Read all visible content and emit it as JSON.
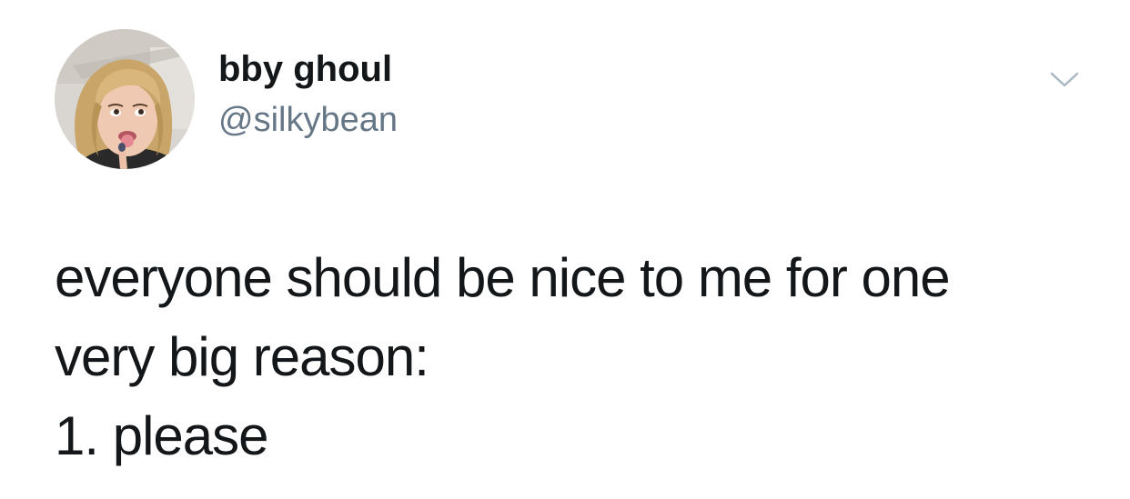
{
  "tweet": {
    "author": {
      "display_name": "bby ghoul",
      "handle": "@silkybean",
      "avatar_icon": "profile-photo"
    },
    "menu_icon": "chevron-down-icon",
    "text_lines": [
      "everyone should be nice to me for one",
      "very big reason:",
      "1. please"
    ]
  },
  "colors": {
    "background": "#ffffff",
    "text_primary": "#14171a",
    "text_secondary": "#657786",
    "caret": "#aab8c2"
  }
}
